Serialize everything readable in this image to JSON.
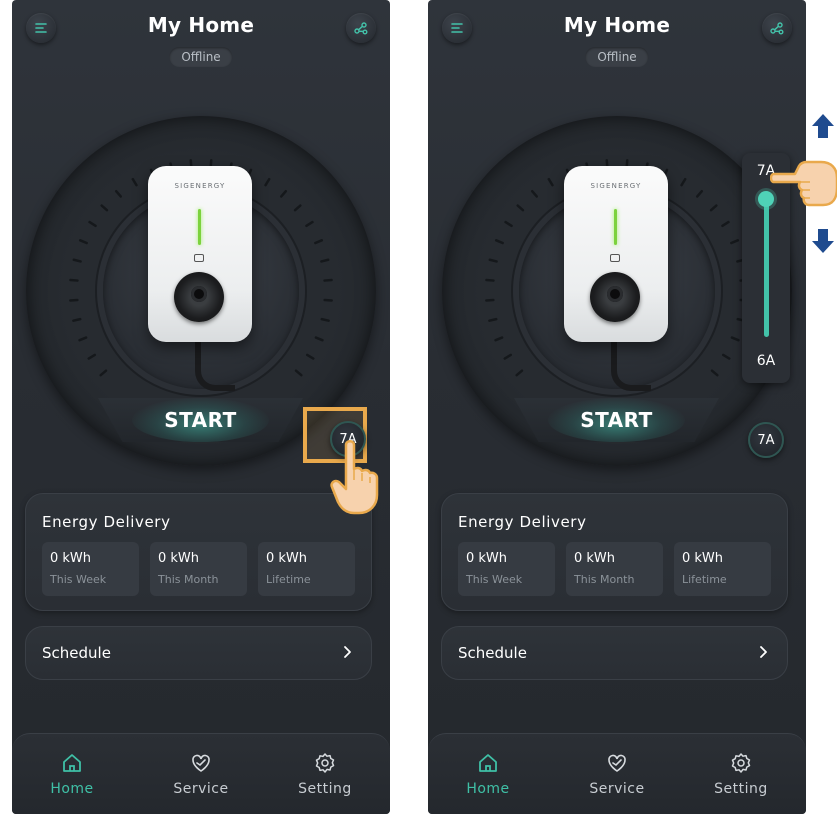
{
  "header": {
    "title": "My Home",
    "status": "Offline"
  },
  "charger": {
    "brand": "SIGENERGY"
  },
  "controls": {
    "start_label": "START",
    "current_setting": "7A"
  },
  "slider": {
    "max_label": "7A",
    "min_label": "6A",
    "level_fraction": 1.0
  },
  "energy": {
    "title": "Energy Delivery",
    "stats": [
      {
        "value": "0 kWh",
        "label": "This Week"
      },
      {
        "value": "0 kWh",
        "label": "This Month"
      },
      {
        "value": "0 kWh",
        "label": "Lifetime"
      }
    ]
  },
  "schedule": {
    "label": "Schedule"
  },
  "nav": {
    "tabs": [
      {
        "label": "Home",
        "icon": "home-icon",
        "active": true
      },
      {
        "label": "Service",
        "icon": "service-heart-icon",
        "active": false
      },
      {
        "label": "Setting",
        "icon": "gear-icon",
        "active": false
      }
    ]
  },
  "colors": {
    "accent": "#3fc0a6",
    "background": "#2a2e34",
    "highlight": "#e9a94c",
    "arrow": "#1f4b8f",
    "led": "#7cd23d"
  }
}
